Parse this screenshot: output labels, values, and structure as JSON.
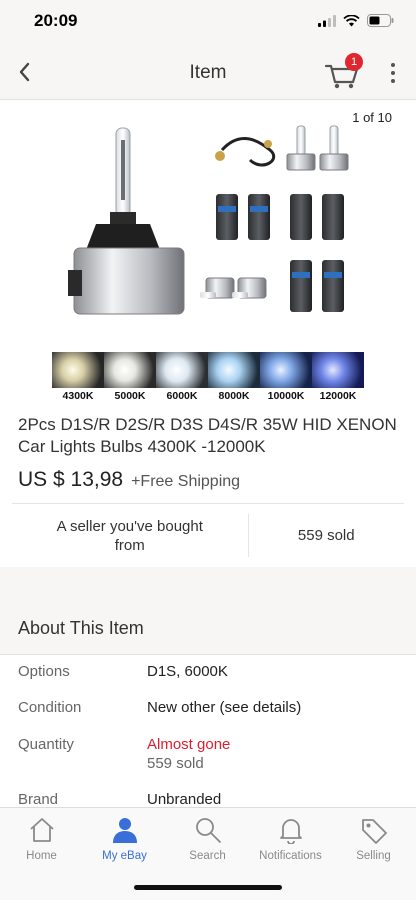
{
  "status_bar": {
    "time": "20:09"
  },
  "nav": {
    "title": "Item",
    "cart_count": "1"
  },
  "gallery": {
    "page_indicator": "1 of 10"
  },
  "color_temps": [
    "4300K",
    "5000K",
    "6000K",
    "8000K",
    "10000K",
    "12000K"
  ],
  "product": {
    "title": "2Pcs D1S/R D2S/R D3S D4S/R 35W HID XENON Car Lights Bulbs 4300K -12000K",
    "price": "US $ 13,98",
    "shipping": "+Free Shipping"
  },
  "seller_info": {
    "seller_note": "A seller you've bought from",
    "sold": "559 sold"
  },
  "about": {
    "title": "About This Item",
    "options_label": "Options",
    "options_value": "D1S, 6000K",
    "condition_label": "Condition",
    "condition_value": "New other (see details)",
    "quantity_label": "Quantity",
    "quantity_value": "Almost gone",
    "quantity_sub": "559 sold",
    "brand_label": "Brand",
    "brand_value": "Unbranded"
  },
  "tabs": {
    "home": "Home",
    "my_ebay": "My eBay",
    "search": "Search",
    "notifications": "Notifications",
    "selling": "Selling"
  },
  "colors": {
    "accent_blue": "#3a6fd8",
    "badge_red": "#e0262f",
    "alert_red": "#dd1e31"
  }
}
